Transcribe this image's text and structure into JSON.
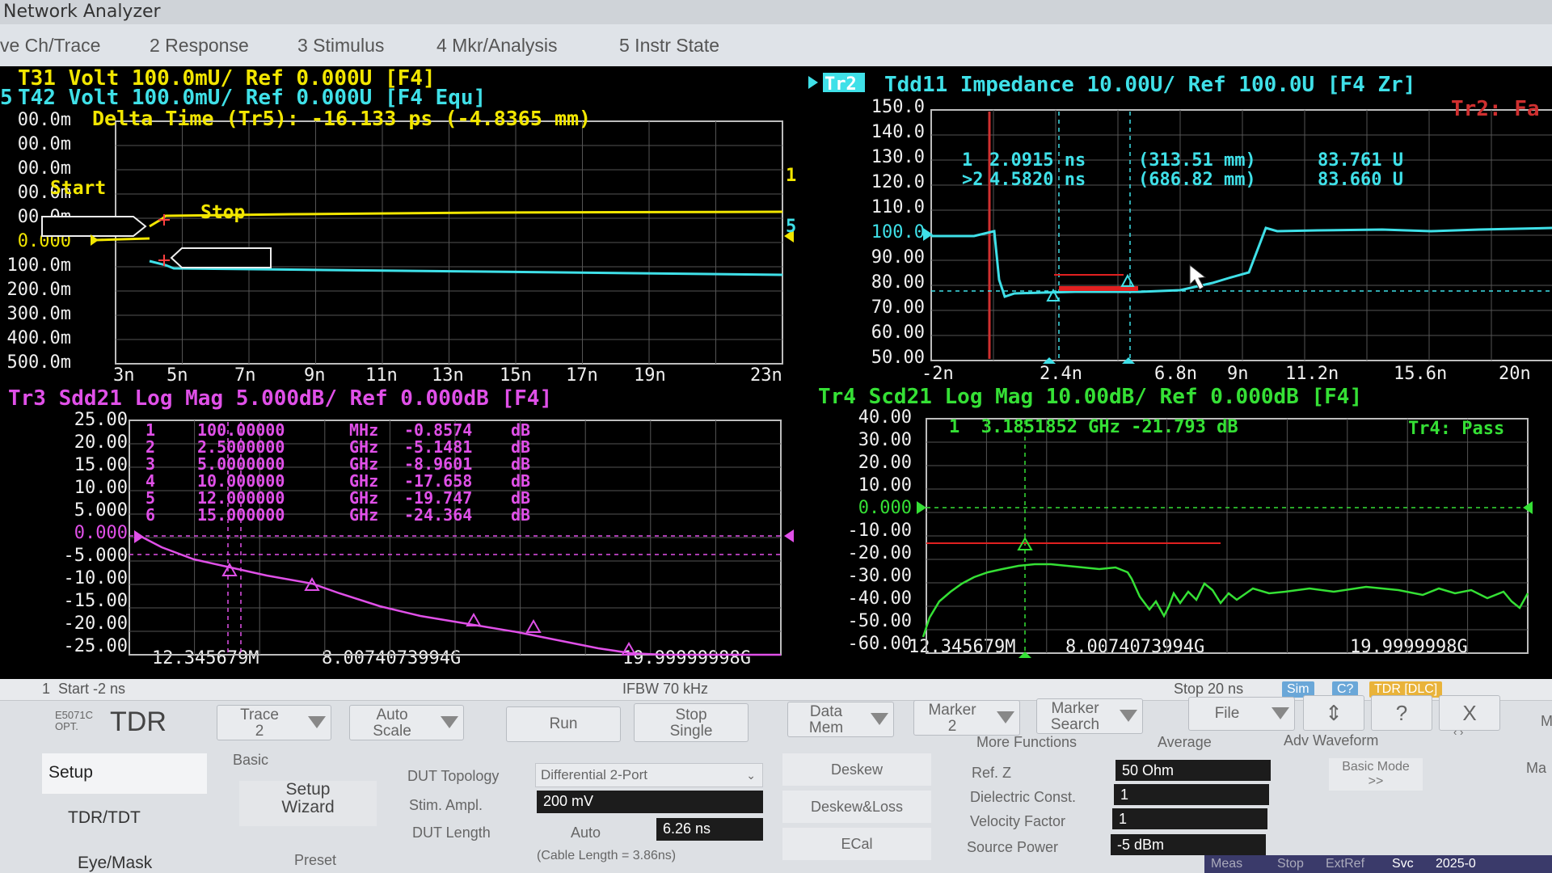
{
  "window_title": "Network Analyzer",
  "menu": [
    "ve Ch/Trace",
    "2 Response",
    "3 Stimulus",
    "4 Mkr/Analysis",
    "5 Instr State"
  ],
  "ch1": {
    "header1": "T31 Volt 100.0mU/ Ref 0.000U [F4]",
    "header2": "T42 Volt 100.0mU/ Ref 0.000U [F4 Equ]",
    "header_prefix": "5",
    "delta_time": "Delta Time (Tr5): -16.133 ps (-4.8365 mm)",
    "yticks": [
      "00.0m",
      "00.0m",
      "00.0m",
      "00.0m",
      "00.0m",
      "0.000",
      "100.0m",
      "200.0m",
      "300.0m",
      "400.0m",
      "500.0m"
    ],
    "xticks": [
      "3n",
      "5n",
      "7n",
      "9n",
      "11n",
      "13n",
      "15n",
      "17n",
      "19n",
      "23n"
    ],
    "start_label": "Start",
    "stop_label": "Stop",
    "trace_labels": [
      "1",
      "5"
    ]
  },
  "ch2": {
    "tr_badge": "Tr2",
    "header": "Tdd11 Impedance 10.00U/ Ref 100.0U [F4 Zr]",
    "corner": "Tr2: Fa",
    "yticks": [
      "150.0",
      "140.0",
      "130.0",
      "120.0",
      "110.0",
      "100.0",
      "90.00",
      "80.00",
      "70.00",
      "60.00",
      "50.00"
    ],
    "xticks": [
      "-2n",
      "2.4n",
      "6.8n",
      "9n",
      "11.2n",
      "15.6n",
      "20n"
    ],
    "markers": [
      {
        "id": "1",
        "time": "2.0915 ns",
        "dist": "(313.51 mm)",
        "value": "83.761 U"
      },
      {
        "id": ">2",
        "time": "4.5820 ns",
        "dist": "(686.82 mm)",
        "value": "83.660 U"
      }
    ]
  },
  "ch3": {
    "header": "Tr3 Sdd21 Log Mag 5.000dB/ Ref 0.000dB [F4]",
    "yticks": [
      "25.00",
      "20.00",
      "15.00",
      "10.00",
      "5.000",
      "0.000",
      "-5.000",
      "-10.00",
      "-15.00",
      "-20.00",
      "-25.00"
    ],
    "xticks": [
      "12.345679M",
      "8.0074073994G",
      "19.99999998G"
    ],
    "markers": [
      {
        "id": "1",
        "freq": "100.00000",
        "unit": "MHz",
        "value": "-0.8574",
        "vunit": "dB"
      },
      {
        "id": "2",
        "freq": "2.5000000",
        "unit": "GHz",
        "value": "-5.1481",
        "vunit": "dB"
      },
      {
        "id": "3",
        "freq": "5.0000000",
        "unit": "GHz",
        "value": "-8.9601",
        "vunit": "dB"
      },
      {
        "id": "4",
        "freq": "10.000000",
        "unit": "GHz",
        "value": "-17.658",
        "vunit": "dB"
      },
      {
        "id": "5",
        "freq": "12.000000",
        "unit": "GHz",
        "value": "-19.747",
        "vunit": "dB"
      },
      {
        "id": "6",
        "freq": "15.000000",
        "unit": "GHz",
        "value": "-24.364",
        "vunit": "dB"
      }
    ]
  },
  "ch4": {
    "header": "Tr4 Scd21 Log Mag 10.00dB/ Ref 0.000dB [F4]",
    "marker": "1  3.1851852 GHz -21.793 dB",
    "corner": "Tr4: Pass",
    "yticks": [
      "40.00",
      "30.00",
      "20.00",
      "10.00",
      "0.000",
      "-10.00",
      "-20.00",
      "-30.00",
      "-40.00",
      "-50.00",
      "-60.00"
    ],
    "xticks": [
      "12.345679M",
      "8.0074073994G",
      "19.9999998G"
    ]
  },
  "status": {
    "start": "1  Start -2 ns",
    "ifbw": "IFBW 70 kHz",
    "stop": "Stop 20 ns",
    "badges": [
      "Sim",
      "C?",
      "TDR [DLC]"
    ]
  },
  "toolbar": {
    "model": "E5071C",
    "option": "OPT.",
    "tdr": "TDR",
    "trace": [
      "Trace",
      "2"
    ],
    "autoscale": [
      "Auto",
      "Scale"
    ],
    "run": "Run",
    "stop_single": [
      "Stop",
      "Single"
    ],
    "data_mem": [
      "Data",
      "Mem"
    ],
    "marker": [
      "Marker",
      "2"
    ],
    "marker_search": [
      "Marker",
      "Search"
    ],
    "file": "File",
    "help": "?",
    "close": "X"
  },
  "nav": [
    "Setup",
    "TDR/TDT",
    "Eye/Mask"
  ],
  "basic": {
    "section": "Basic",
    "setup_wizard": [
      "Setup",
      "Wizard"
    ],
    "preset": "Preset",
    "dut_topology_label": "DUT Topology",
    "dut_topology_value": "Differential 2-Port",
    "stim_ampl_label": "Stim. Ampl.",
    "stim_ampl_value": "200 mV",
    "dut_length_label": "DUT Length",
    "dut_length_auto": "Auto",
    "dut_length_value": "6.26 ns",
    "cable_length": "(Cable Length = 3.86ns)"
  },
  "mid_buttons": [
    "Deskew",
    "Deskew&Loss",
    "ECal"
  ],
  "more": {
    "headers": [
      "More Functions",
      "Average",
      "Adv Waveform"
    ],
    "ref_z_label": "Ref. Z",
    "ref_z_value": "50 Ohm",
    "dielectric_label": "Dielectric Const.",
    "dielectric_value": "1",
    "velocity_label": "Velocity Factor",
    "velocity_value": "1",
    "source_power_label": "Source Power",
    "source_power_value": "-5 dBm",
    "basic_mode": "Basic Mode",
    "basic_mode_arrow": ">>",
    "right_edge": [
      "M",
      "Ma"
    ]
  },
  "footer": [
    "Meas",
    "Stop",
    "ExtRef",
    "Svc",
    "2025-0"
  ]
}
